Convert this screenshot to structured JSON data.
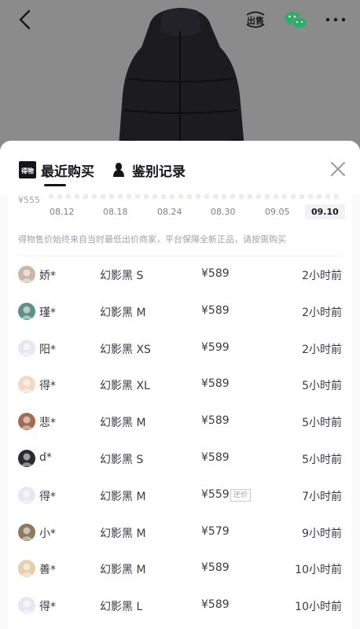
{
  "topbar": {
    "icons": [
      "back-icon",
      "sell-icon",
      "wechat-icon",
      "more-icon"
    ],
    "sell_label": "出售"
  },
  "tabs": [
    {
      "label": "最近购买",
      "icon": "dewu-logo-icon",
      "logo_text": "得物",
      "active": true
    },
    {
      "label": "鉴别记录",
      "icon": "silhouette-icon",
      "active": false
    }
  ],
  "chart": {
    "y_min_label": "¥555",
    "x_labels": [
      "08.12",
      "08.18",
      "08.24",
      "08.30",
      "09.05",
      "09.10"
    ],
    "active_x": "09.10"
  },
  "notice": "得物售价始终来自当时最低出价商家，平台保障全新正品，请按需购买",
  "records": [
    {
      "user": "娇*",
      "property": "幻影黑 S",
      "price": "¥589",
      "tag": "",
      "time": "2小时前",
      "avatar_color": "#c9b8a8"
    },
    {
      "user": "瑾*",
      "property": "幻影黑 M",
      "price": "¥589",
      "tag": "",
      "time": "2小时前",
      "avatar_color": "#5f8f8a"
    },
    {
      "user": "阳*",
      "property": "幻影黑 XS",
      "price": "¥599",
      "tag": "",
      "time": "2小时前",
      "avatar_color": "#e8e6f0"
    },
    {
      "user": "得*",
      "property": "幻影黑 XL",
      "price": "¥589",
      "tag": "",
      "time": "5小时前",
      "avatar_color": "#f2d9c4"
    },
    {
      "user": "悲*",
      "property": "幻影黑 M",
      "price": "¥589",
      "tag": "",
      "time": "5小时前",
      "avatar_color": "#a36b52"
    },
    {
      "user": "d*",
      "property": "幻影黑 S",
      "price": "¥589",
      "tag": "",
      "time": "5小时前",
      "avatar_color": "#2a2a30"
    },
    {
      "user": "得*",
      "property": "幻影黑 M",
      "price": "¥559",
      "tag": "还价",
      "time": "7小时前",
      "avatar_color": "#e8e6f0"
    },
    {
      "user": "小*",
      "property": "幻影黑 M",
      "price": "¥579",
      "tag": "",
      "time": "9小时前",
      "avatar_color": "#8b7a5c"
    },
    {
      "user": "善*",
      "property": "幻影黑 M",
      "price": "¥589",
      "tag": "",
      "time": "10小时前",
      "avatar_color": "#e6cfae"
    },
    {
      "user": "得*",
      "property": "幻影黑 L",
      "price": "¥589",
      "tag": "",
      "time": "10小时前",
      "avatar_color": "#e8e6f0"
    }
  ],
  "colors": {
    "text_primary": "#16161a",
    "text_secondary": "#a2a2aa",
    "wechat_green": "#2aae67"
  }
}
